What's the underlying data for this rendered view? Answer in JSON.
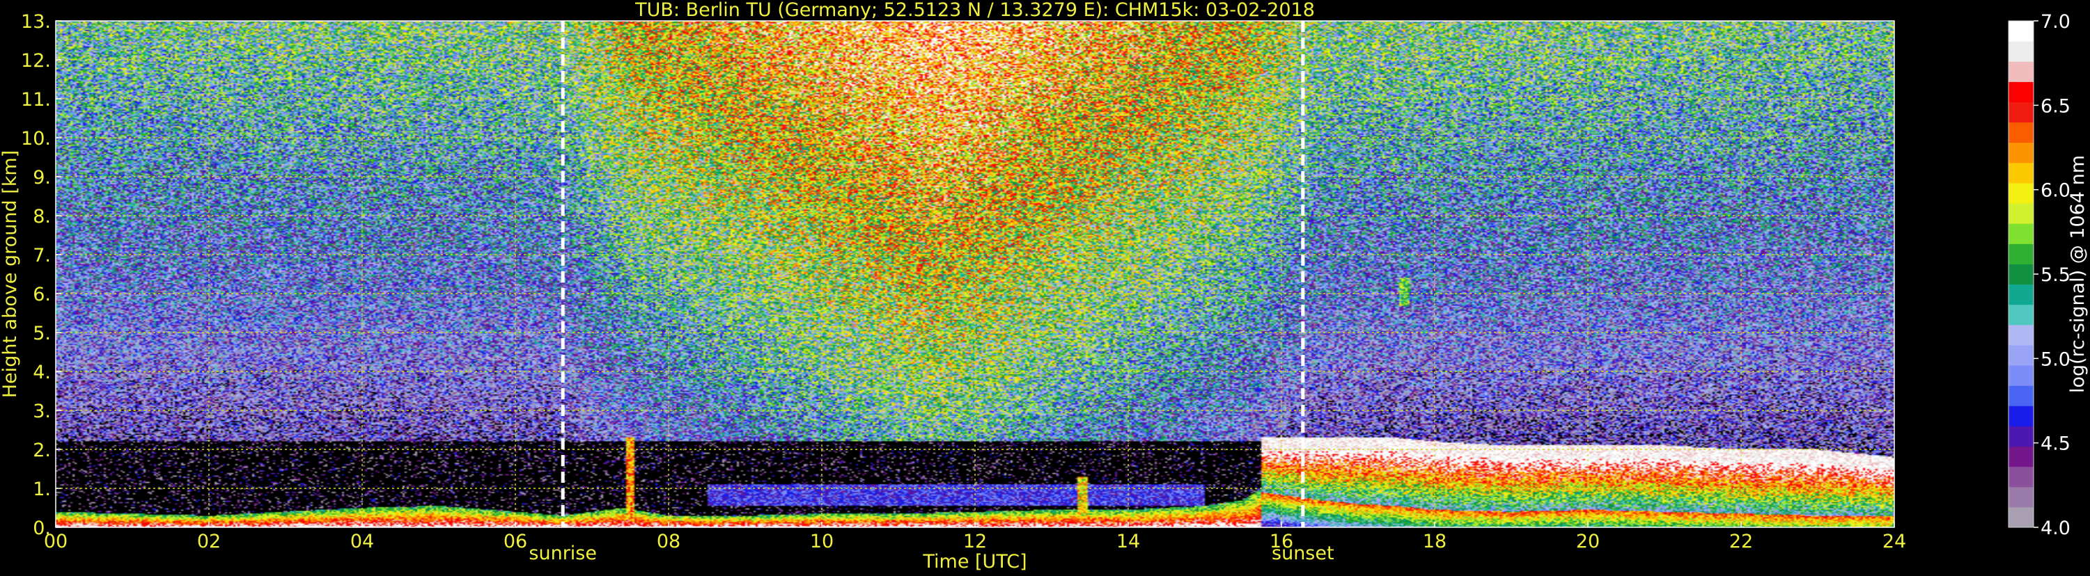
{
  "chart_data": {
    "type": "heatmap",
    "title": "TUB: Berlin TU (Germany; 52.5123 N / 13.3279 E):    CHM15k: 03-02-2018",
    "xlabel": "Time [UTC]",
    "ylabel": "Height above ground [km]",
    "xlim": [
      0,
      24
    ],
    "ylim": [
      0,
      13
    ],
    "x_ticks": [
      {
        "value": 0,
        "label": "00"
      },
      {
        "value": 2,
        "label": "02"
      },
      {
        "value": 4,
        "label": "04"
      },
      {
        "value": 6,
        "label": "06"
      },
      {
        "value": 8,
        "label": "08"
      },
      {
        "value": 10,
        "label": "10"
      },
      {
        "value": 12,
        "label": "12"
      },
      {
        "value": 14,
        "label": "14"
      },
      {
        "value": 16,
        "label": "16"
      },
      {
        "value": 18,
        "label": "18"
      },
      {
        "value": 20,
        "label": "20"
      },
      {
        "value": 22,
        "label": "22"
      },
      {
        "value": 24,
        "label": "24"
      }
    ],
    "y_ticks": [
      {
        "value": 0,
        "label": "0."
      },
      {
        "value": 1,
        "label": "1."
      },
      {
        "value": 2,
        "label": "2."
      },
      {
        "value": 3,
        "label": "3."
      },
      {
        "value": 4,
        "label": "4."
      },
      {
        "value": 5,
        "label": "5."
      },
      {
        "value": 6,
        "label": "6."
      },
      {
        "value": 7,
        "label": "7."
      },
      {
        "value": 8,
        "label": "8."
      },
      {
        "value": 9,
        "label": "9."
      },
      {
        "value": 10,
        "label": "10."
      },
      {
        "value": 11,
        "label": "11."
      },
      {
        "value": 12,
        "label": "12."
      },
      {
        "value": 13,
        "label": "13."
      }
    ],
    "grid": true,
    "annotations": [
      {
        "label": "sunrise",
        "x": 6.62
      },
      {
        "label": "sunset",
        "x": 16.28
      }
    ],
    "colorbar": {
      "label": "log(rc-signal) @ 1064 nm",
      "range": [
        4.0,
        7.0
      ],
      "ticks": [
        {
          "value": 4.0,
          "label": "4.0"
        },
        {
          "value": 4.5,
          "label": "4.5"
        },
        {
          "value": 5.0,
          "label": "5.0"
        },
        {
          "value": 5.5,
          "label": "5.5"
        },
        {
          "value": 6.0,
          "label": "6.0"
        },
        {
          "value": 6.5,
          "label": "6.5"
        },
        {
          "value": 7.0,
          "label": "7.0"
        }
      ],
      "colors": [
        "#a8a0b0",
        "#9a7aa8",
        "#8a509c",
        "#74168c",
        "#4c18b0",
        "#1a1cea",
        "#4a64f4",
        "#7c8cf8",
        "#9aa4f6",
        "#b0b8f4",
        "#50c8c0",
        "#10a890",
        "#109040",
        "#30b030",
        "#80e030",
        "#d0f030",
        "#f4f010",
        "#fcc800",
        "#fc9400",
        "#fa5c00",
        "#f01c10",
        "#fc0000",
        "#f0bcbc",
        "#ececec",
        "#ffffff"
      ]
    },
    "background_signal": [
      {
        "x": 0,
        "low_level": 4.3,
        "high_level": 5.4
      },
      {
        "x": 6.6,
        "low_level": 4.3,
        "high_level": 5.5
      },
      {
        "x": 7.5,
        "low_level": 4.6,
        "high_level": 6.0
      },
      {
        "x": 11.5,
        "low_level": 5.3,
        "high_level": 6.6
      },
      {
        "x": 15.5,
        "low_level": 4.6,
        "high_level": 6.0
      },
      {
        "x": 16.5,
        "low_level": 4.3,
        "high_level": 5.5
      },
      {
        "x": 24,
        "low_level": 4.3,
        "high_level": 5.4
      }
    ],
    "boundary_layer": [
      {
        "x": 0.0,
        "height": 0.4
      },
      {
        "x": 1.0,
        "height": 0.35
      },
      {
        "x": 2.0,
        "height": 0.3
      },
      {
        "x": 3.0,
        "height": 0.4
      },
      {
        "x": 4.0,
        "height": 0.5
      },
      {
        "x": 5.0,
        "height": 0.55
      },
      {
        "x": 6.0,
        "height": 0.4
      },
      {
        "x": 6.6,
        "height": 0.3
      },
      {
        "x": 7.4,
        "height": 0.5
      },
      {
        "x": 8.0,
        "height": 0.3
      },
      {
        "x": 9.0,
        "height": 0.3
      },
      {
        "x": 10.0,
        "height": 0.35
      },
      {
        "x": 11.0,
        "height": 0.35
      },
      {
        "x": 12.0,
        "height": 0.4
      },
      {
        "x": 13.0,
        "height": 0.45
      },
      {
        "x": 14.0,
        "height": 0.45
      },
      {
        "x": 15.0,
        "height": 0.55
      },
      {
        "x": 15.5,
        "height": 0.7
      },
      {
        "x": 15.75,
        "height": 1.0
      }
    ],
    "cloud_layer": {
      "x": [
        15.75,
        16.5,
        17.0,
        17.5,
        18.0,
        19.0,
        20.0,
        21.0,
        22.0,
        23.0,
        23.5,
        24.0
      ],
      "top": [
        2.3,
        2.3,
        2.3,
        2.3,
        2.2,
        2.1,
        2.1,
        2.1,
        2.0,
        2.0,
        1.9,
        1.8
      ],
      "base": [
        0.9,
        0.7,
        0.6,
        0.55,
        0.45,
        0.4,
        0.45,
        0.4,
        0.35,
        0.3,
        0.3,
        0.3
      ]
    },
    "aerosol_layer": {
      "x_start": 8.5,
      "x_end": 15.0,
      "bottom": 0.55,
      "top": 1.1,
      "level": 4.7
    },
    "features": [
      {
        "x": 7.5,
        "bottom": 0.3,
        "top": 2.3,
        "level": 6.2
      },
      {
        "x": 13.4,
        "bottom": 0.3,
        "top": 1.3,
        "level": 6.0
      },
      {
        "x": 17.6,
        "bottom": 5.7,
        "top": 6.4,
        "level": 5.6
      }
    ]
  }
}
